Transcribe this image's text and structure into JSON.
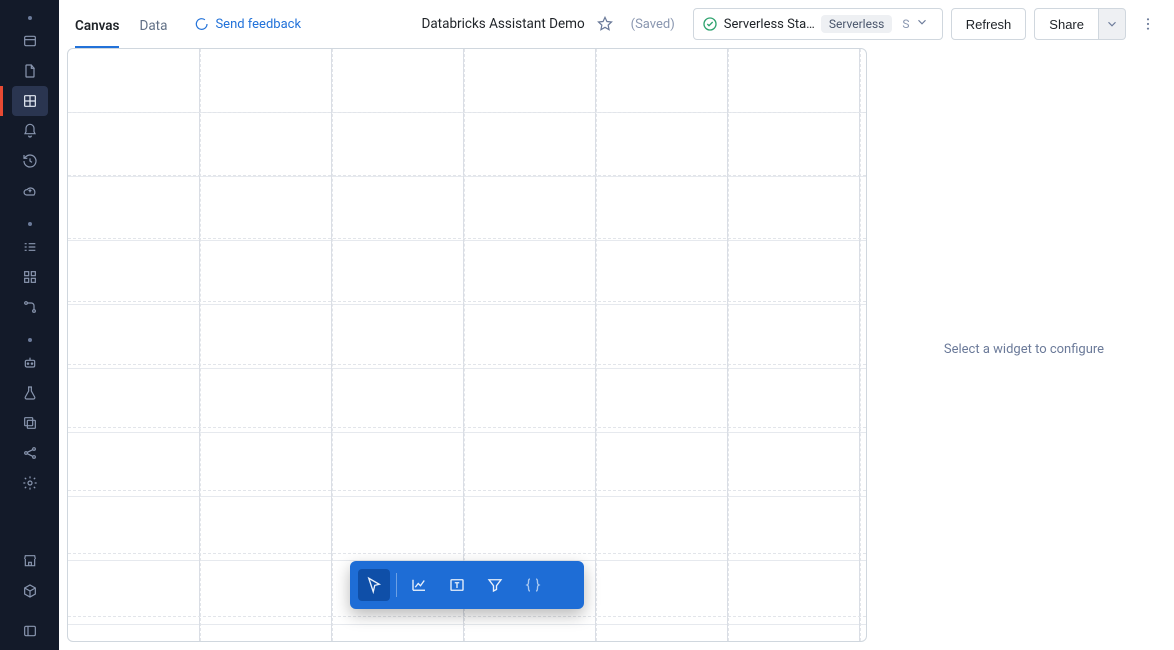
{
  "sidebar": {
    "groups": [
      {
        "items": [
          {
            "name": "home-icon"
          },
          {
            "name": "file-icon"
          },
          {
            "name": "dashboard-icon",
            "active": true
          },
          {
            "name": "bell-icon"
          },
          {
            "name": "history-icon"
          },
          {
            "name": "cloud-icon"
          }
        ]
      },
      {
        "items": [
          {
            "name": "list-icon"
          },
          {
            "name": "schema-icon"
          },
          {
            "name": "link-icon"
          }
        ]
      },
      {
        "items": [
          {
            "name": "robot-icon"
          },
          {
            "name": "beaker-icon"
          },
          {
            "name": "copy-icon"
          },
          {
            "name": "share-nodes-icon"
          },
          {
            "name": "gear-icon"
          }
        ]
      }
    ],
    "bottom": [
      {
        "name": "store-icon"
      },
      {
        "name": "cube-icon"
      },
      {
        "name": "collapse-icon"
      }
    ]
  },
  "topbar": {
    "tabs": [
      {
        "label": "Canvas",
        "active": true
      },
      {
        "label": "Data",
        "active": false
      }
    ],
    "feedback_label": "Send feedback",
    "title": "Databricks Assistant Demo",
    "saved_label": "(Saved)",
    "cluster": {
      "status": "running",
      "name": "Serverless Sta…",
      "tag": "Serverless",
      "suffix": "S"
    },
    "refresh_label": "Refresh",
    "share_label": "Share"
  },
  "right_panel_hint": "Select a widget to configure",
  "floating_toolbar": {
    "items": [
      {
        "name": "cursor-icon",
        "selected": true
      },
      {
        "name": "chart-line-icon"
      },
      {
        "name": "text-box-icon"
      },
      {
        "name": "filter-icon"
      },
      {
        "name": "braces-icon",
        "dim": true
      }
    ]
  }
}
